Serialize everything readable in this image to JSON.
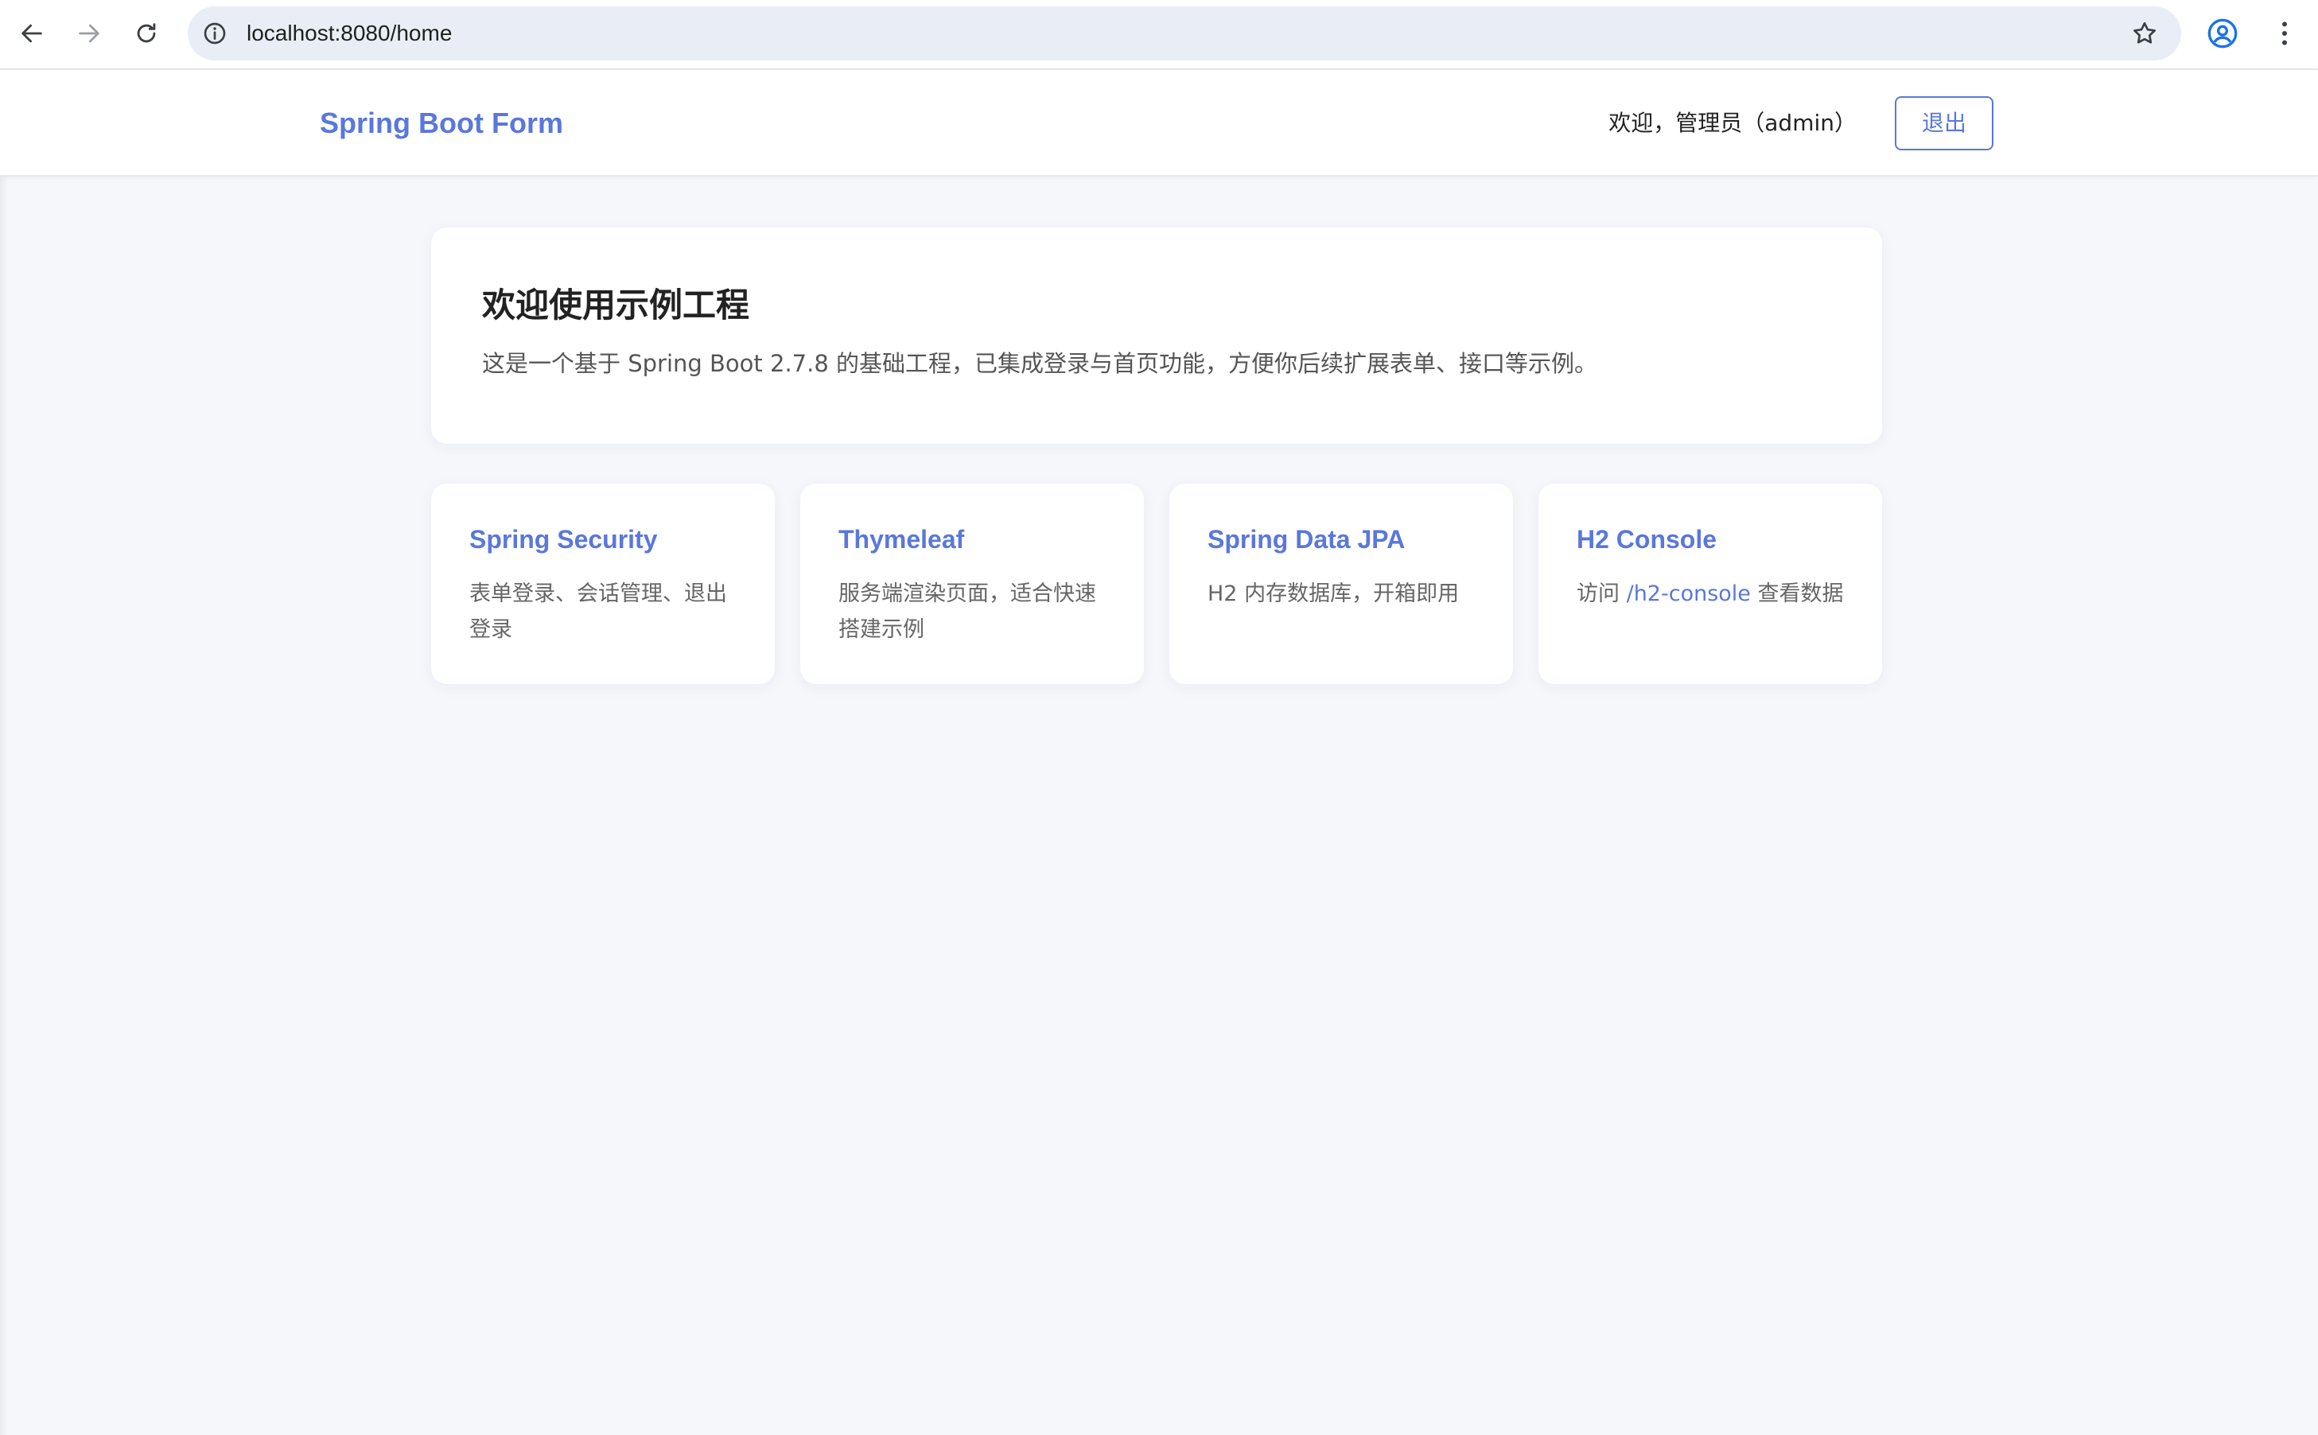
{
  "browser": {
    "url": "localhost:8080/home"
  },
  "header": {
    "brand": "Spring Boot Form",
    "welcome": "欢迎，管理员（admin）",
    "logout_label": "退出"
  },
  "hero": {
    "title": "欢迎使用示例工程",
    "description": "这是一个基于 Spring Boot 2.7.8 的基础工程，已集成登录与首页功能，方便你后续扩展表单、接口等示例。"
  },
  "features": [
    {
      "title": "Spring Security",
      "description": "表单登录、会话管理、退出登录"
    },
    {
      "title": "Thymeleaf",
      "description": "服务端渲染页面，适合快速搭建示例"
    },
    {
      "title": "Spring Data JPA",
      "description": "H2 内存数据库，开箱即用"
    },
    {
      "title": "H2 Console",
      "description_prefix": "访问 ",
      "link_text": "/h2-console",
      "description_suffix": " 查看数据"
    }
  ],
  "colors": {
    "accent": "#5a77dc",
    "page_background": "#f5f7fb",
    "card_background": "#ffffff"
  },
  "icons": {
    "back": "arrow-left-icon",
    "forward": "arrow-right-icon",
    "reload": "reload-icon",
    "site_info": "info-icon",
    "bookmark": "star-icon",
    "profile": "profile-icon",
    "menu": "more-vert-icon"
  }
}
